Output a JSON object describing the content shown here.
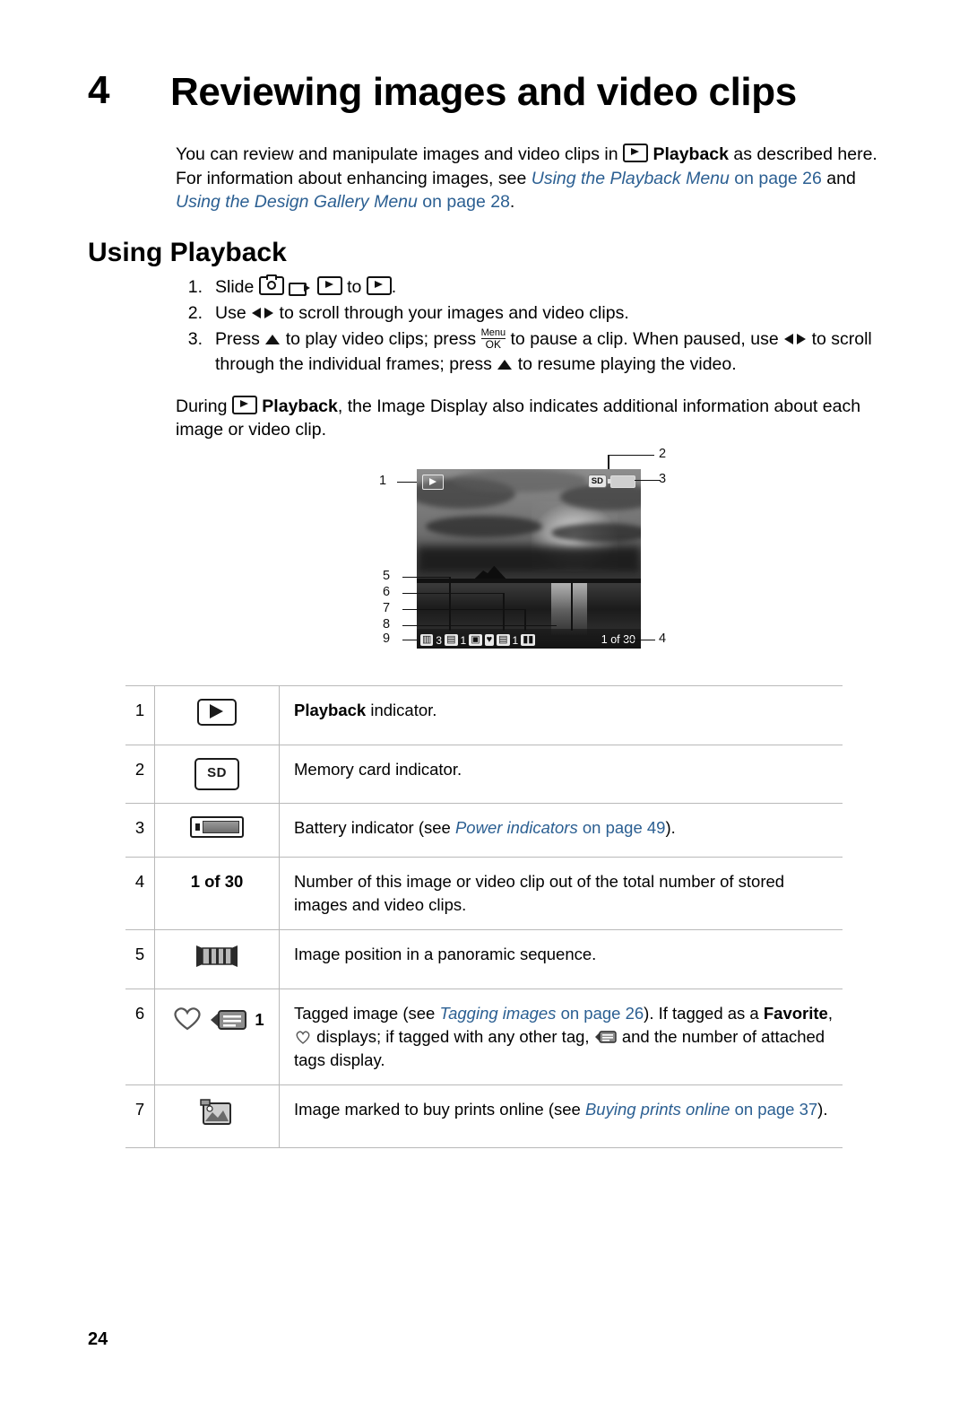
{
  "chapter": {
    "number": "4",
    "title": "Reviewing images and video clips"
  },
  "intro": {
    "part1": "You can review and manipulate images and video clips in ",
    "playback_bold": "Playback",
    "part2": " as described here. For information about enhancing images, see ",
    "link1": "Using the Playback Menu",
    "part3": " on page 26 ",
    "part3b": "and ",
    "link2": "Using the Design Gallery Menu",
    "part4": " on page ",
    "page_ref": "28",
    "period": "."
  },
  "section": {
    "title": "Using Playback"
  },
  "steps": [
    {
      "num": "1.",
      "text_a": "Slide",
      "text_b": "to",
      "text_c": "."
    },
    {
      "num": "2.",
      "text_a": "Use",
      "text_b": "to scroll through your images and video clips."
    },
    {
      "num": "3.",
      "text_a": "Press",
      "text_b": "to play video clips; press",
      "menu_label": "Menu",
      "ok_label": "OK",
      "text_c": "to pause a clip. When paused, use",
      "text_d": "to scroll through the individual frames; press",
      "text_e": "to resume playing the video."
    }
  ],
  "after_list": {
    "part1": "During ",
    "playback_bold": "Playback",
    "part2": ", the Image Display also indicates additional information about each image or video clip."
  },
  "figure": {
    "callouts": [
      "1",
      "2",
      "3",
      "4",
      "5",
      "6",
      "7",
      "8",
      "9"
    ],
    "osd": {
      "pano_count": "3",
      "tag_count": "1",
      "tag_num": "1",
      "image_count": "1 of 30"
    },
    "sd_label": "SD"
  },
  "table": {
    "rows": [
      {
        "num": "1",
        "icon": "playback-icon",
        "desc_bold": "Playback",
        "desc_rest": " indicator."
      },
      {
        "num": "2",
        "icon": "sd-card-icon",
        "icon_label": "SD",
        "desc_rest": "Memory card indicator."
      },
      {
        "num": "3",
        "icon": "battery-icon",
        "desc_pre": "Battery indicator (see ",
        "desc_link": "Power indicators",
        "desc_mid": " on page ",
        "desc_page": "49",
        "desc_post": ")."
      },
      {
        "num": "4",
        "icon_text": "1 of 30",
        "desc_rest": "Number of this image or video clip out of the total number of stored images and video clips."
      },
      {
        "num": "5",
        "icon": "panorama-icon",
        "desc_rest": "Image position in a panoramic sequence."
      },
      {
        "num": "6",
        "icon": "heart-icon",
        "icon2": "tag-icon",
        "icon2_count": "1",
        "desc_pre": "Tagged image (see ",
        "desc_link": "Tagging images",
        "desc_mid": " on page ",
        "desc_page": "26",
        "desc_post": "). If tagged as a ",
        "desc_fav": "Favorite",
        "desc_post2": ", ",
        "desc_post3": " displays; if tagged with any other tag, ",
        "desc_post4": " and the number of attached tags display."
      },
      {
        "num": "7",
        "icon": "print-order-icon",
        "desc_pre": "Image marked to buy prints online (see ",
        "desc_link": "Buying prints online",
        "desc_mid": "on page ",
        "desc_page": "37",
        "desc_post": ")."
      }
    ]
  },
  "footer": {
    "page_number": "24"
  }
}
